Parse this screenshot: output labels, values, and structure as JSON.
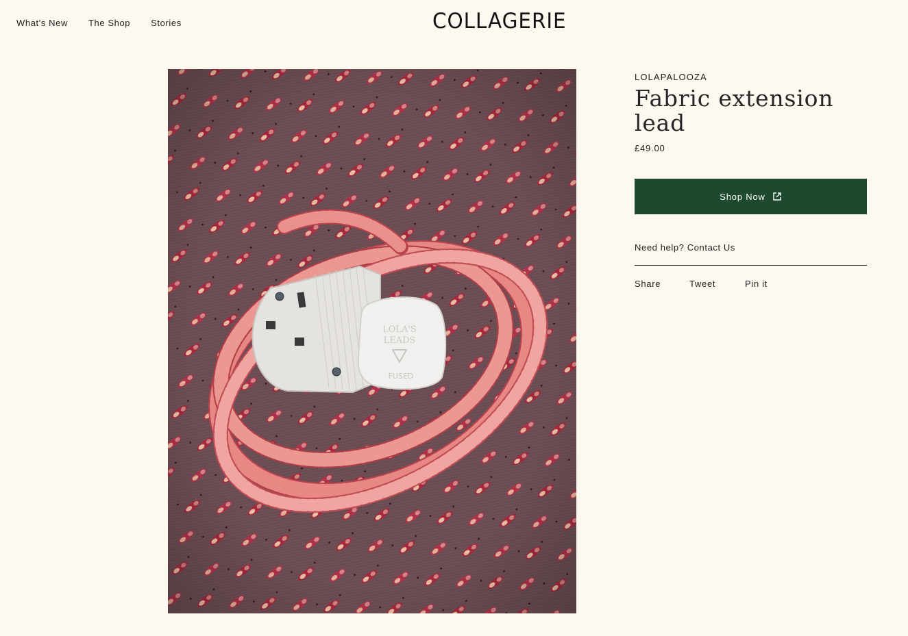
{
  "nav": {
    "items": [
      "What's New",
      "The Shop",
      "Stories"
    ]
  },
  "logo": {
    "text": "COLLAGERIE"
  },
  "product": {
    "image": {
      "description_icon": "twisted-pink-fabric-extension-lead-photo",
      "plug_text_top": "LOLA'S",
      "plug_text_bottom": "LEADS",
      "plug_text_fused": "FUSED"
    },
    "brand": "LOLAPALOOZA",
    "title": "Fabric extension lead",
    "price": "£49.00",
    "shop_button": {
      "label": "Shop Now",
      "icon": "external-link-icon"
    },
    "help": {
      "text": "Need help? Contact Us"
    },
    "share": {
      "share_label": "Share",
      "tweet_label": "Tweet",
      "pin_label": "Pin it"
    }
  },
  "colors": {
    "background": "#fdf9f1",
    "button": "#1d4a2e",
    "button_text": "#ffffff",
    "text": "#1f1f1f"
  }
}
